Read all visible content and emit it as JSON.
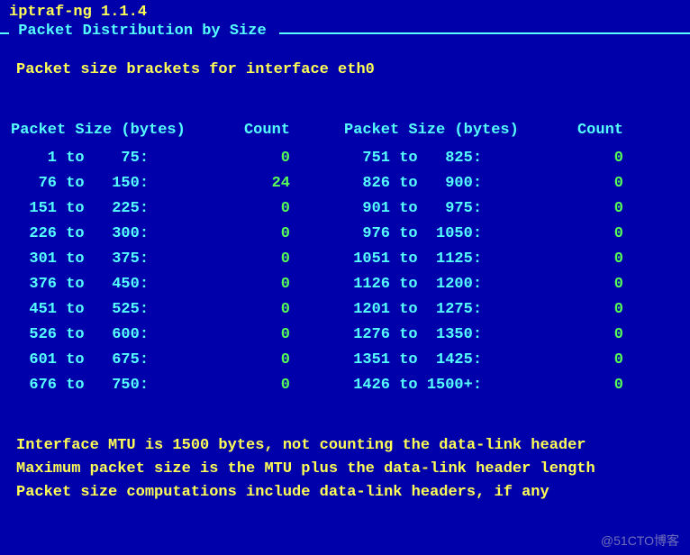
{
  "app_title": "iptraf-ng 1.1.4",
  "box_title": " Packet Distribution by Size ",
  "subtitle": "Packet size brackets for interface eth0",
  "headers": {
    "size": "Packet Size (bytes)",
    "count": "Count"
  },
  "left_rows": [
    {
      "from": "1",
      "to": "75",
      "count": "0"
    },
    {
      "from": "76",
      "to": "150",
      "count": "24"
    },
    {
      "from": "151",
      "to": "225",
      "count": "0"
    },
    {
      "from": "226",
      "to": "300",
      "count": "0"
    },
    {
      "from": "301",
      "to": "375",
      "count": "0"
    },
    {
      "from": "376",
      "to": "450",
      "count": "0"
    },
    {
      "from": "451",
      "to": "525",
      "count": "0"
    },
    {
      "from": "526",
      "to": "600",
      "count": "0"
    },
    {
      "from": "601",
      "to": "675",
      "count": "0"
    },
    {
      "from": "676",
      "to": "750",
      "count": "0"
    }
  ],
  "right_rows": [
    {
      "from": "751",
      "to": "825",
      "count": "0"
    },
    {
      "from": "826",
      "to": "900",
      "count": "0"
    },
    {
      "from": "901",
      "to": "975",
      "count": "0"
    },
    {
      "from": "976",
      "to": "1050",
      "count": "0"
    },
    {
      "from": "1051",
      "to": "1125",
      "count": "0"
    },
    {
      "from": "1126",
      "to": "1200",
      "count": "0"
    },
    {
      "from": "1201",
      "to": "1275",
      "count": "0"
    },
    {
      "from": "1276",
      "to": "1350",
      "count": "0"
    },
    {
      "from": "1351",
      "to": "1425",
      "count": "0"
    },
    {
      "from": "1426",
      "to": "1500+",
      "count": "0"
    }
  ],
  "notes": [
    "Interface MTU is 1500 bytes, not counting the data-link header",
    "Maximum packet size is the MTU plus the data-link header length",
    "Packet size computations include data-link headers, if any"
  ],
  "watermark": "@51CTO博客"
}
